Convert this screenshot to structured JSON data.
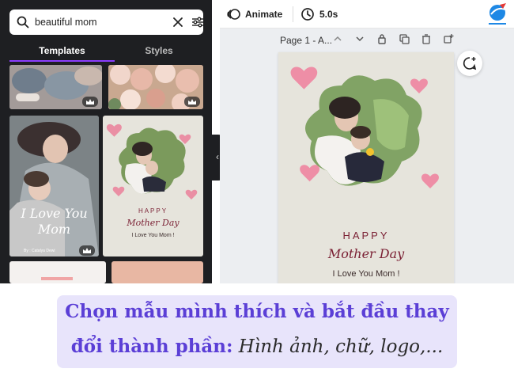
{
  "search": {
    "value": "beautiful mom",
    "icon": "search-icon"
  },
  "tabs": [
    {
      "label": "Templates",
      "active": true
    },
    {
      "label": "Styles",
      "active": false
    }
  ],
  "templates": {
    "big": {
      "title": "I Love You Mom",
      "credit": "By : Catalya Dewi"
    },
    "small": {
      "happy": "HAPPY",
      "mother_day": "Mother Day",
      "love": "I Love You Mom !"
    }
  },
  "toolbar": {
    "animate_label": "Animate",
    "duration_label": "5.0s"
  },
  "page": {
    "title": "Page 1 - A..."
  },
  "design": {
    "happy": "HAPPY",
    "mother_day": "Mother Day",
    "love": "I Love You Mom !"
  },
  "caption": {
    "line1": "Chọn mẫu mình thích và bắt đầu thay",
    "line2_bold": "đổi thành phần:",
    "line2_italic": " Hình ảnh, chữ, logo,..."
  },
  "colors": {
    "accent": "#8b3dff",
    "caption_text": "#5b3fd6",
    "design_text": "#7a1f33",
    "caption_bg": "#e8e4fb"
  }
}
